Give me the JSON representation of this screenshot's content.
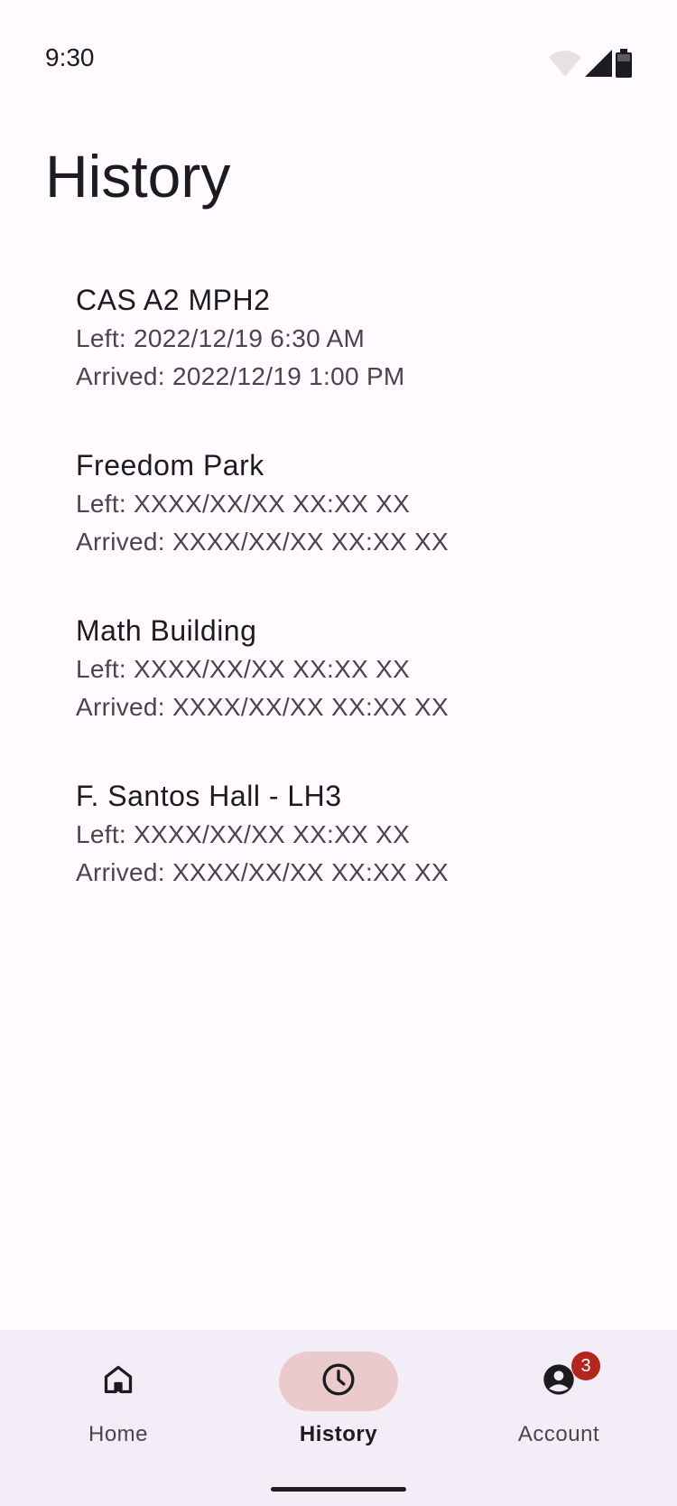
{
  "status_bar": {
    "time": "9:30",
    "icons": [
      "wifi-icon",
      "cell-signal-icon",
      "battery-icon"
    ]
  },
  "page": {
    "title": "History"
  },
  "history": [
    {
      "place": "CAS A2 MPH2",
      "left": "Left: 2022/12/19 6:30 AM",
      "arrived": "Arrived: 2022/12/19 1:00 PM"
    },
    {
      "place": "Freedom Park",
      "left": "Left: XXXX/XX/XX XX:XX XX",
      "arrived": "Arrived: XXXX/XX/XX XX:XX XX"
    },
    {
      "place": "Math Building",
      "left": "Left: XXXX/XX/XX XX:XX XX",
      "arrived": "Arrived: XXXX/XX/XX XX:XX XX"
    },
    {
      "place": "F. Santos Hall - LH3",
      "left": "Left: XXXX/XX/XX XX:XX XX",
      "arrived": "Arrived: XXXX/XX/XX XX:XX XX"
    }
  ],
  "bottom_nav": {
    "items": [
      {
        "label": "Home",
        "icon": "home-icon"
      },
      {
        "label": "History",
        "icon": "clock-icon",
        "active": true
      },
      {
        "label": "Account",
        "icon": "account-circle-icon",
        "badge": "3"
      }
    ]
  },
  "colors": {
    "background": "#FFFBFE",
    "nav_background": "#F3EDF7",
    "active_indicator": "#EBCACC",
    "badge": "#B3261E",
    "text_primary": "#1C1B1F",
    "text_secondary": "#49454F"
  }
}
